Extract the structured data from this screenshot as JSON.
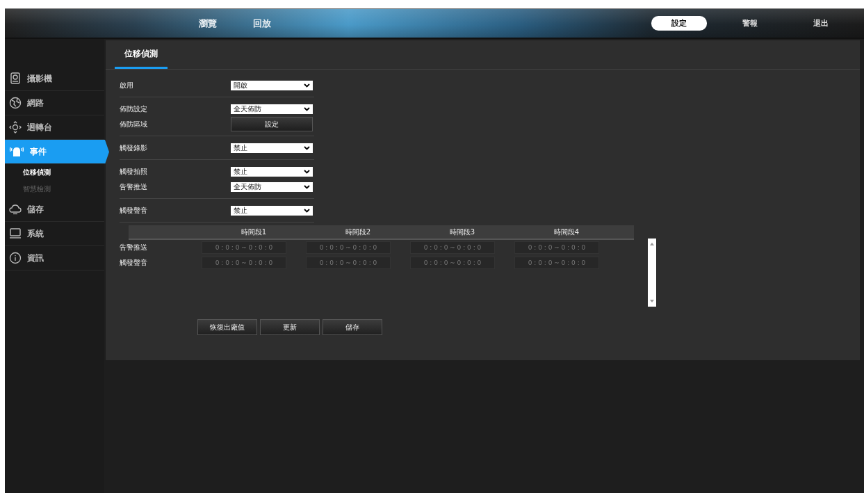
{
  "top_nav": {
    "left": [
      {
        "label": "瀏覽",
        "selected": false
      },
      {
        "label": "回放",
        "selected": false
      }
    ],
    "right": [
      {
        "label": "設定",
        "selected": true
      },
      {
        "label": "警報",
        "selected": false
      },
      {
        "label": "退出",
        "selected": false
      }
    ]
  },
  "sidebar": {
    "items": [
      {
        "label": "攝影機",
        "selected": false
      },
      {
        "label": "網路",
        "selected": false
      },
      {
        "label": "迴轉台",
        "selected": false
      },
      {
        "label": "事件",
        "selected": true,
        "children": [
          {
            "label": "位移偵測",
            "selected": true
          },
          {
            "label": "智慧檢測",
            "selected": false
          }
        ]
      },
      {
        "label": "儲存",
        "selected": false
      },
      {
        "label": "系統",
        "selected": false
      },
      {
        "label": "資訊",
        "selected": false
      }
    ]
  },
  "tabs": [
    {
      "label": "位移偵測",
      "selected": true
    }
  ],
  "settings": [
    [
      {
        "label": "啟用",
        "kind": "select",
        "value": "開啟"
      }
    ],
    [
      {
        "label": "佈防設定",
        "kind": "select",
        "value": "全天佈防"
      },
      {
        "label": "佈防區域",
        "kind": "button",
        "value": "設定"
      }
    ],
    [
      {
        "label": "觸發錄影",
        "kind": "select",
        "value": "禁止"
      }
    ],
    [
      {
        "label": "觸發拍照",
        "kind": "select",
        "value": "禁止"
      },
      {
        "label": "告警推送",
        "kind": "select",
        "value": "全天佈防"
      }
    ],
    [
      {
        "label": "觸發聲音",
        "kind": "select",
        "value": "禁止"
      }
    ]
  ],
  "schedule": {
    "columns": [
      "時間段1",
      "時間段2",
      "時間段3",
      "時間段4"
    ],
    "rows": [
      {
        "label": "告警推送",
        "cells": [
          "0 : 0 : 0 ~ 0 : 0 : 0",
          "0 : 0 : 0 ~ 0 : 0 : 0",
          "0 : 0 : 0 ~ 0 : 0 : 0",
          "0 : 0 : 0 ~ 0 : 0 : 0"
        ]
      },
      {
        "label": "觸發聲音",
        "cells": [
          "0 : 0 : 0 ~ 0 : 0 : 0",
          "0 : 0 : 0 ~ 0 : 0 : 0",
          "0 : 0 : 0 ~ 0 : 0 : 0",
          "0 : 0 : 0 ~ 0 : 0 : 0"
        ]
      }
    ]
  },
  "buttons": [
    "恢復出廠值",
    "更新",
    "儲存"
  ]
}
